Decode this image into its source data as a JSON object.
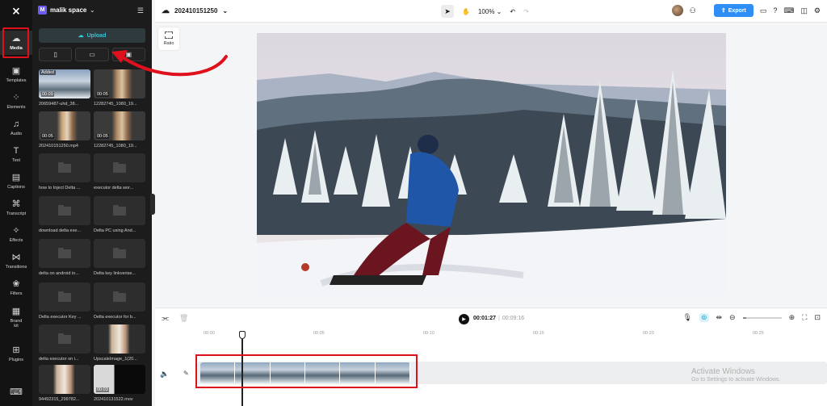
{
  "rail": {
    "items": [
      {
        "label": "Media",
        "icon": "cloud-icon"
      },
      {
        "label": "Templates",
        "icon": "templates-icon"
      },
      {
        "label": "Elements",
        "icon": "elements-icon"
      },
      {
        "label": "Audio",
        "icon": "audio-icon"
      },
      {
        "label": "Text",
        "icon": "text-icon"
      },
      {
        "label": "Captions",
        "icon": "captions-icon"
      },
      {
        "label": "Transcript",
        "icon": "transcript-icon"
      },
      {
        "label": "Effects",
        "icon": "effects-icon"
      },
      {
        "label": "Transitions",
        "icon": "transitions-icon"
      },
      {
        "label": "Filters",
        "icon": "filters-icon"
      },
      {
        "label": "Brand kit",
        "icon": "brand-kit-icon"
      },
      {
        "label": "Plugins",
        "icon": "plugins-icon"
      }
    ]
  },
  "panel": {
    "space_badge": "M",
    "space_name": "malik space",
    "upload_label": "Upload",
    "media": [
      {
        "name": "20659487-uhd_38...",
        "duration": "00:09",
        "tag": "Added"
      },
      {
        "name": "12282745_1080_19...",
        "duration": "00:05",
        "tag": ""
      },
      {
        "name": "20241015125​0.mp4",
        "duration": "00:05",
        "tag": ""
      },
      {
        "name": "12282745_1080_19...",
        "duration": "00:05",
        "tag": ""
      },
      {
        "name": "how to Inject Delta ...",
        "duration": "",
        "tag": ""
      },
      {
        "name": "executor delta wor...",
        "duration": "",
        "tag": ""
      },
      {
        "name": "download delta exe...",
        "duration": "",
        "tag": ""
      },
      {
        "name": "Delta PC using And...",
        "duration": "",
        "tag": ""
      },
      {
        "name": "delta on android in...",
        "duration": "",
        "tag": ""
      },
      {
        "name": "Delta key linkverise...",
        "duration": "",
        "tag": ""
      },
      {
        "name": "Delta executor Key ...",
        "duration": "",
        "tag": ""
      },
      {
        "name": "Delta executor for b...",
        "duration": "",
        "tag": ""
      },
      {
        "name": "delta executor on i...",
        "duration": "",
        "tag": ""
      },
      {
        "name": "UpscaleImage_1(20...",
        "duration": "",
        "tag": ""
      },
      {
        "name": "94492315_299782...",
        "duration": "",
        "tag": ""
      },
      {
        "name": "20241013​1522.mov",
        "duration": "00:03",
        "tag": ""
      }
    ]
  },
  "topbar": {
    "doc_name": "202410151250",
    "zoom": "100%",
    "export_label": "Export"
  },
  "ratio_label": "Ratio",
  "timeline": {
    "current_time": "00:01:27",
    "total_time": "00:09:16",
    "ticks": [
      "00:00",
      "00:05",
      "00:10",
      "00:15",
      "00:20",
      "00:25"
    ]
  },
  "watermark": {
    "line1": "Activate Windows",
    "line2": "Go to Settings to activate Windows."
  },
  "colors": {
    "accent": "#2f8ef5",
    "annotation": "#e0111c",
    "upload_text": "#35c5d6"
  }
}
